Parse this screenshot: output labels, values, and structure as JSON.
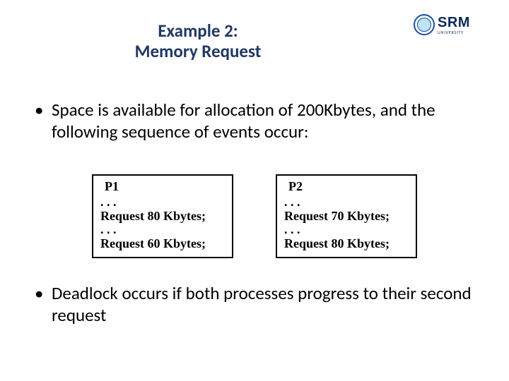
{
  "logo": {
    "main": "SRM",
    "sub": "UNIVERSITY"
  },
  "title": {
    "line1": "Example 2:",
    "line2": "Memory Request"
  },
  "bullets": {
    "b1": "Space is available for allocation of 200Kbytes, and the following sequence of events occur:",
    "b2": "Deadlock occurs if both processes progress to their second request"
  },
  "processes": [
    {
      "name": "P1",
      "lines": [
        ". . .",
        "Request 80 Kbytes;",
        ". . .",
        "Request 60 Kbytes;"
      ]
    },
    {
      "name": "P2",
      "lines": [
        ". . .",
        "Request 70 Kbytes;",
        ". . .",
        "Request 80 Kbytes;"
      ]
    }
  ]
}
